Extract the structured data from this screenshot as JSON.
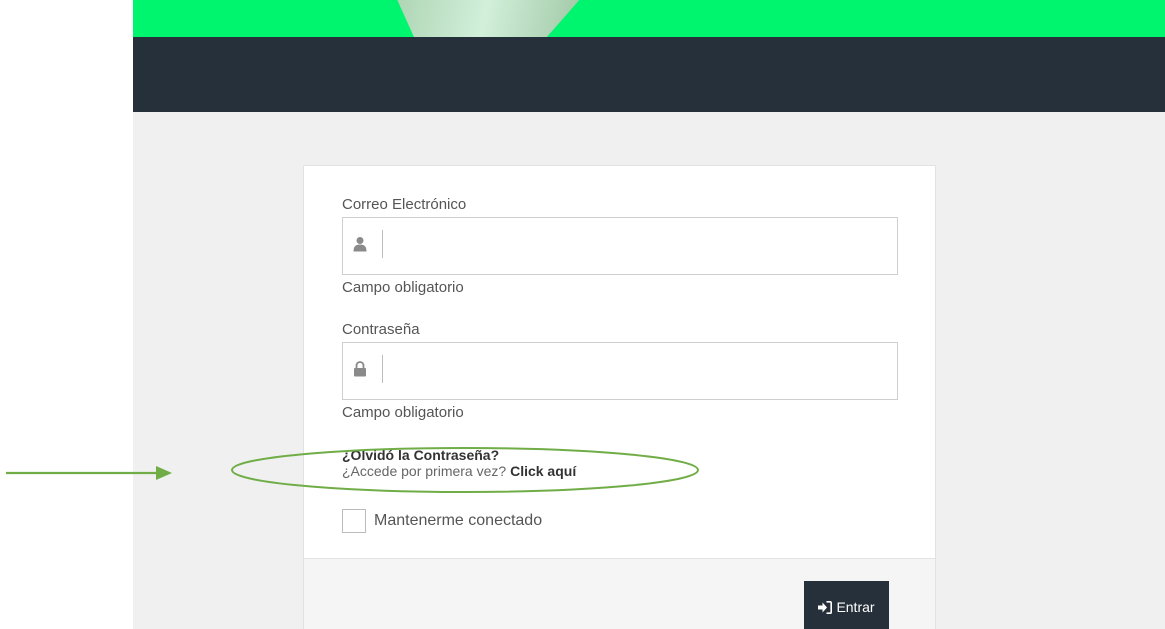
{
  "form": {
    "email": {
      "label": "Correo Electrónico",
      "value": "",
      "help": "Campo obligatorio",
      "icon": "user-icon"
    },
    "password": {
      "label": "Contraseña",
      "value": "",
      "help": "Campo obligatorio",
      "icon": "lock-icon"
    },
    "forgot_password": "¿Olvidó la Contraseña?",
    "first_access_prompt": "¿Accede por primera vez?",
    "first_access_link": "Click aquí",
    "remember_me": {
      "label": "Mantenerme conectado",
      "checked": false
    },
    "submit": {
      "label": "Entrar",
      "icon": "sign-in-icon"
    }
  },
  "colors": {
    "accent_green": "#00f56e",
    "header_dark": "#26303a",
    "annotation_green": "#70ad47"
  }
}
